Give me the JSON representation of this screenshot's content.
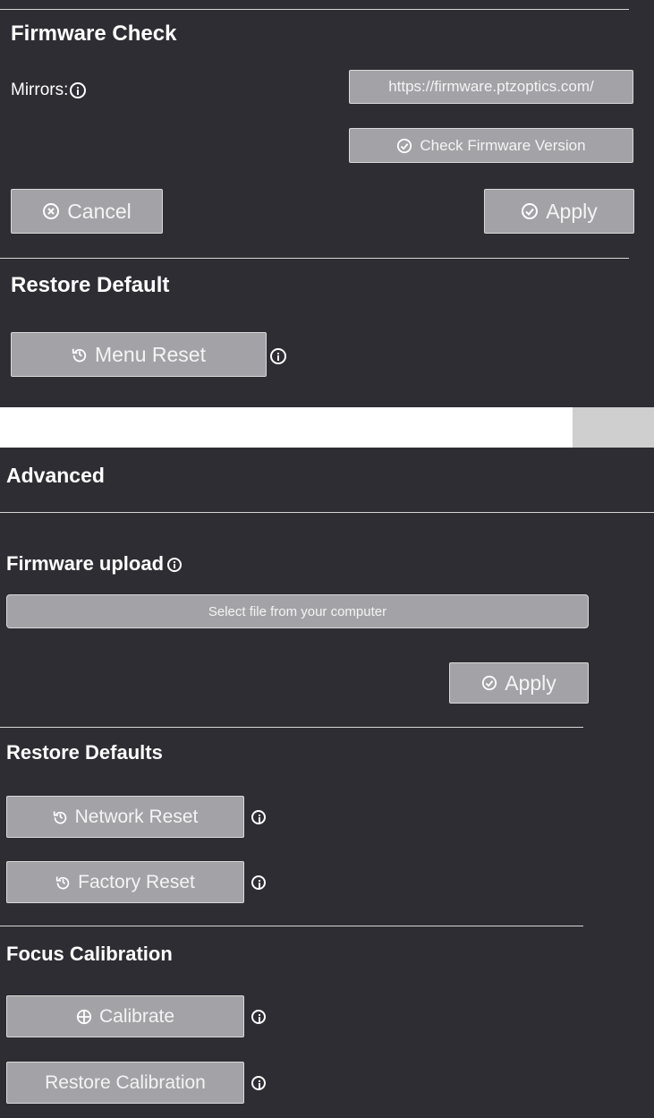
{
  "firmware_check": {
    "title": "Firmware Check",
    "mirrors_label": "Mirrors:",
    "mirror_url": "https://firmware.ptzoptics.com/",
    "check_button": "Check Firmware Version",
    "cancel_button": "Cancel",
    "apply_button": "Apply"
  },
  "restore_default": {
    "title": "Restore Default",
    "menu_reset_button": "Menu Reset"
  },
  "advanced": {
    "title": "Advanced",
    "firmware_upload": {
      "title": "Firmware upload",
      "select_file_button": "Select file from your computer",
      "apply_button": "Apply"
    },
    "restore_defaults": {
      "title": "Restore Defaults",
      "network_reset_button": "Network Reset",
      "factory_reset_button": "Factory Reset"
    },
    "focus_calibration": {
      "title": "Focus Calibration",
      "calibrate_button": "Calibrate",
      "restore_calibration_button": "Restore Calibration"
    }
  },
  "colors": {
    "background": "#2e2d33",
    "button": "#a3a2a7",
    "text": "#ffffff"
  }
}
